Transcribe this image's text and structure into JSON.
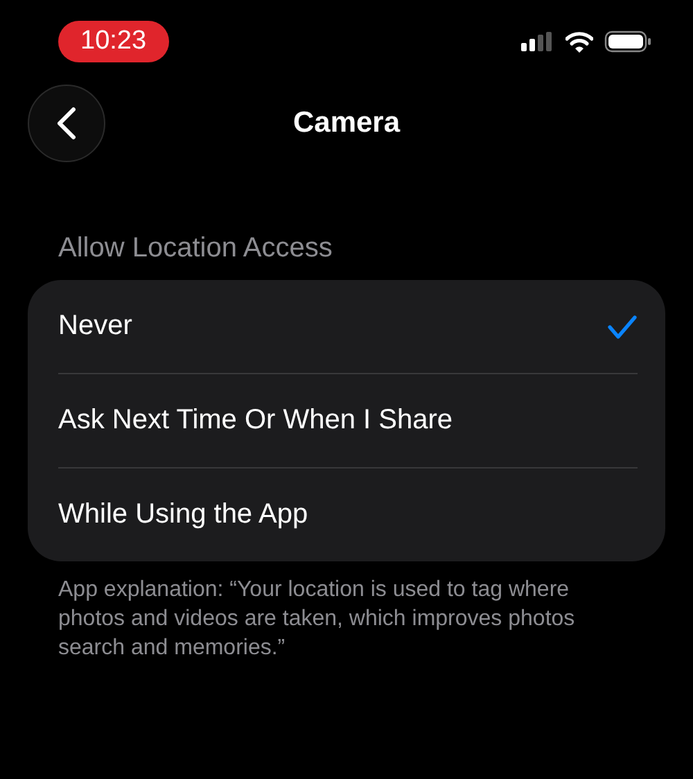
{
  "status_bar": {
    "time": "10:23"
  },
  "nav": {
    "title": "Camera"
  },
  "section": {
    "header": "Allow Location Access",
    "options": [
      {
        "label": "Never",
        "selected": true
      },
      {
        "label": "Ask Next Time Or When I Share",
        "selected": false
      },
      {
        "label": "While Using the App",
        "selected": false
      }
    ],
    "footer": "App explanation: “Your location is used to tag where photos and videos are taken, which improves photos search and memories.”"
  }
}
